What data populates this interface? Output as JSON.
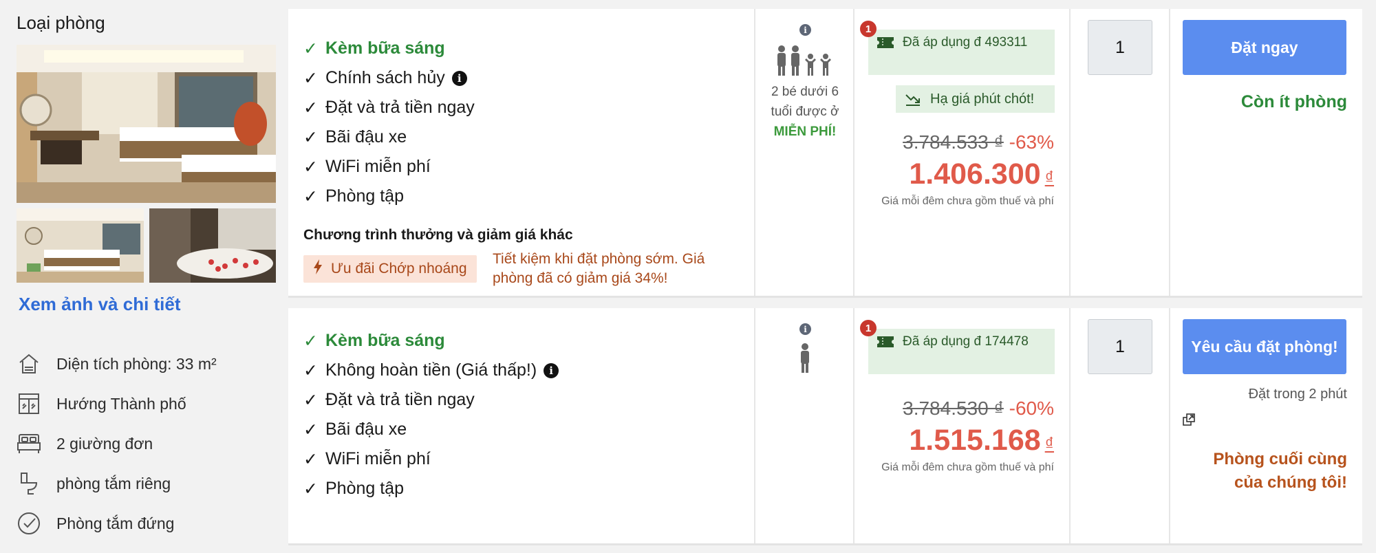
{
  "left": {
    "title": "Loại phòng",
    "see_details": "Xem ảnh và chi tiết",
    "facilities": [
      {
        "icon": "home-area-icon",
        "label": "Diện tích phòng: 33 m²"
      },
      {
        "icon": "window-icon",
        "label": "Hướng Thành phố"
      },
      {
        "icon": "bed-icon",
        "label": "2 giường đơn"
      },
      {
        "icon": "toilet-icon",
        "label": "phòng tắm riêng"
      },
      {
        "icon": "check-circle-icon",
        "label": "Phòng tắm đứng"
      }
    ]
  },
  "rows": [
    {
      "benefits": {
        "breakfast": "Kèm bữa sáng",
        "policy": "Chính sách hủy",
        "pay": "Đặt và trả tiền ngay",
        "parking": "Bãi đậu xe",
        "wifi": "WiFi miễn phí",
        "gym": "Phòng tập"
      },
      "promo_title": "Chương trình thưởng và giảm giá khác",
      "promo_badge": "Ưu đãi Chớp nhoáng",
      "promo_text": "Tiết kiệm khi đặt phòng sớm. Giá phòng đã có giảm giá 34%!",
      "occupancy": {
        "info": "i",
        "note": "2 bé dưới 6 tuổi được ở",
        "free": "MIỄN PHÍ!"
      },
      "coupon_count": "1",
      "coupon": "Đã áp dụng đ 493311",
      "last_minute": "Hạ giá phút chót!",
      "old_price": "3.784.533 ₫",
      "discount": "-63%",
      "new_price": "1.406.300",
      "currency": "₫",
      "price_note": "Giá mỗi đêm chưa gồm thuế và phí",
      "quantity": "1",
      "button": "Đặt ngay",
      "availability": "Còn ít phòng"
    },
    {
      "benefits": {
        "breakfast": "Kèm bữa sáng",
        "policy": "Không hoàn tiền (Giá thấp!)",
        "pay": "Đặt và trả tiền ngay",
        "parking": "Bãi đậu xe",
        "wifi": "WiFi miễn phí",
        "gym": "Phòng tập"
      },
      "occupancy": {
        "info": "i"
      },
      "coupon_count": "1",
      "coupon": "Đã áp dụng đ 174478",
      "old_price": "3.784.530 ₫",
      "discount": "-60%",
      "new_price": "1.515.168",
      "currency": "₫",
      "price_note": "Giá mỗi đêm chưa gồm thuế và phí",
      "quantity": "1",
      "button": "Yêu cầu đặt phòng!",
      "book_time": "Đặt trong 2 phút",
      "last_room": "Phòng cuối cùng của chúng tôi!"
    }
  ],
  "colors": {
    "accent_blue": "#5b8def",
    "link_blue": "#2f6bd6",
    "green": "#2c8a3a",
    "price_red": "#e05a4a",
    "orange": "#b7531d"
  }
}
